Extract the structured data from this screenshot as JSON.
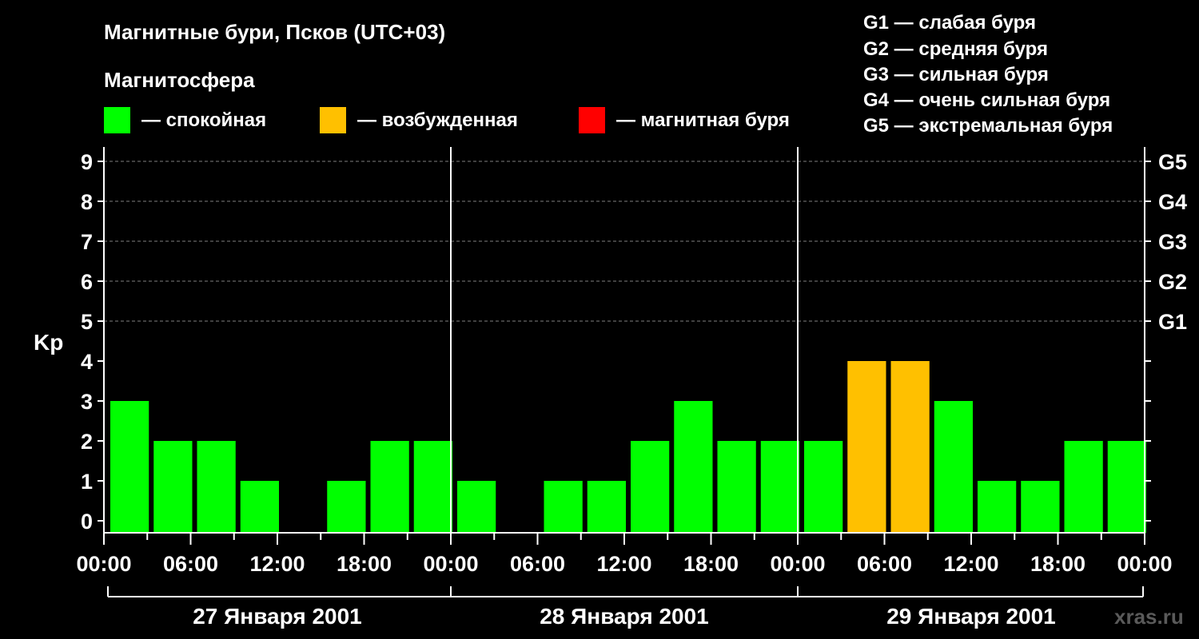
{
  "title": "Магнитные бури, Псков (UTC+03)",
  "legend": {
    "heading": "Магнитосфера",
    "items": [
      {
        "label": "— спокойная",
        "color": "#00ff00"
      },
      {
        "label": "— возбужденная",
        "color": "#ffc000"
      },
      {
        "label": "— магнитная буря",
        "color": "#ff0000"
      }
    ]
  },
  "g_scale": [
    "G1 — слабая буря",
    "G2 — средняя буря",
    "G3 — сильная буря",
    "G4 — очень сильная буря",
    "G5 — экстремальная буря"
  ],
  "watermark": "xras.ru",
  "chart_data": {
    "type": "bar",
    "ylabel": "Kp",
    "ylim": [
      0,
      9
    ],
    "yticks": [
      "0",
      "1",
      "2",
      "3",
      "4",
      "5",
      "6",
      "7",
      "8",
      "9"
    ],
    "right_ticks": [
      {
        "value": 5,
        "label": "G1"
      },
      {
        "value": 6,
        "label": "G2"
      },
      {
        "value": 7,
        "label": "G3"
      },
      {
        "value": 8,
        "label": "G4"
      },
      {
        "value": 9,
        "label": "G5"
      }
    ],
    "xtick_labels": [
      "00:00",
      "06:00",
      "12:00",
      "18:00",
      "00:00",
      "06:00",
      "12:00",
      "18:00",
      "00:00",
      "06:00",
      "12:00",
      "18:00",
      "00:00"
    ],
    "days": [
      "27 Января 2001",
      "28 Января 2001",
      "29 Января 2001"
    ],
    "values": [
      3,
      2,
      2,
      1,
      0,
      1,
      2,
      2,
      1,
      0,
      1,
      1,
      2,
      3,
      2,
      2,
      2,
      4,
      4,
      3,
      1,
      1,
      2,
      2
    ],
    "colors": {
      "quiet": "#00ff00",
      "active": "#ffc000",
      "storm": "#ff0000"
    },
    "grid": "dashed horizontal at 5–9"
  }
}
